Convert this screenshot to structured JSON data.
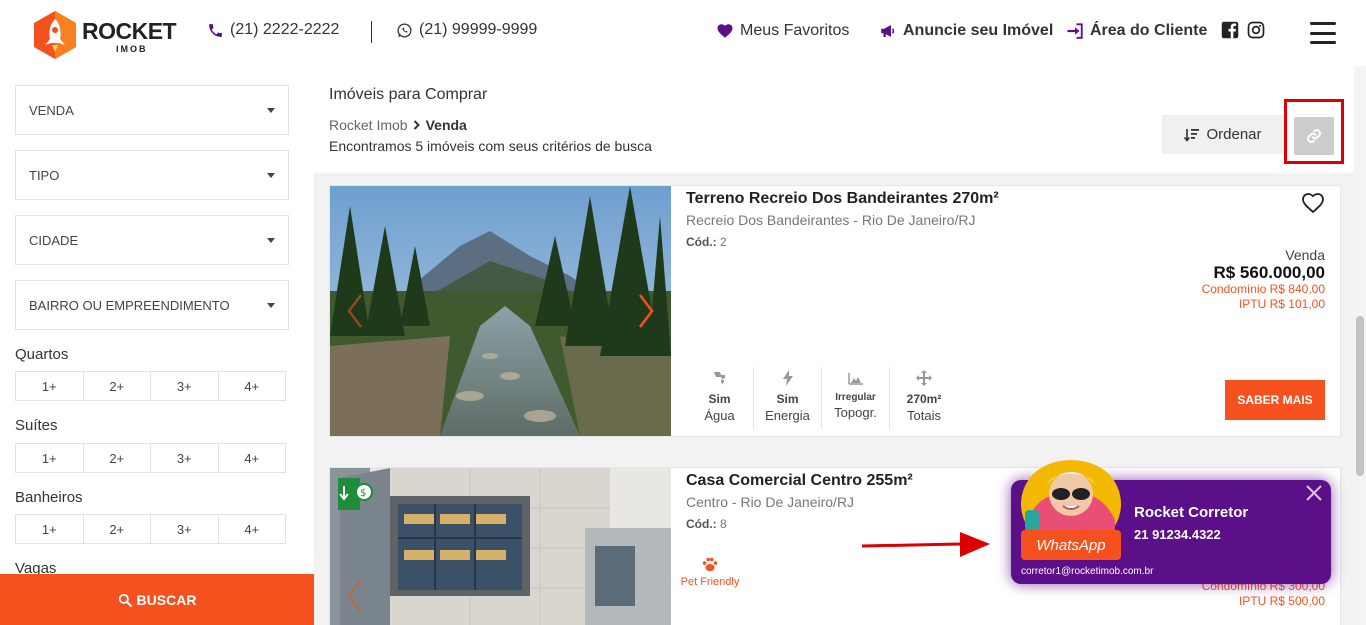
{
  "brand": {
    "name": "ROCKET",
    "sub": "IMOB"
  },
  "header": {
    "phone": "(21) 2222-2222",
    "whatsapp": "(21) 99999-9999",
    "favorites": "Meus Favoritos",
    "advertise": "Anuncie seu Imóvel",
    "client_area": "Área do Cliente",
    "icons": [
      "phone-icon",
      "whatsapp-icon",
      "heart-icon",
      "megaphone-icon",
      "sign-in-icon",
      "facebook-icon",
      "instagram-icon",
      "menu-icon"
    ]
  },
  "filters": {
    "selects": [
      "VENDA",
      "TIPO",
      "CIDADE",
      "BAIRRO OU EMPREENDIMENTO"
    ],
    "groups": [
      {
        "label": "Quartos",
        "options": [
          "1+",
          "2+",
          "3+",
          "4+"
        ]
      },
      {
        "label": "Suítes",
        "options": [
          "1+",
          "2+",
          "3+",
          "4+"
        ]
      },
      {
        "label": "Banheiros",
        "options": [
          "1+",
          "2+",
          "3+",
          "4+"
        ]
      },
      {
        "label": "Vagas"
      }
    ],
    "search_label": "BUSCAR"
  },
  "page": {
    "title": "Imóveis para Comprar",
    "breadcrumb": {
      "root": "Rocket Imob",
      "current": "Venda"
    },
    "result_count": "Encontramos 5 imóveis com seus critérios de busca",
    "order_label": "Ordenar"
  },
  "listings": [
    {
      "title": "Terreno Recreio Dos Bandeirantes 270m²",
      "location": "Recreio Dos Bandeirantes - Rio De Janeiro/RJ",
      "code_label": "Cód.:",
      "code": "2",
      "price_kind": "Venda",
      "price": "R$ 560.000,00",
      "condo": "Condomínio R$ 840,00",
      "iptu": "IPTU R$ 101,00",
      "features": [
        {
          "icon": "water-icon",
          "value": "Sim",
          "label": "Água"
        },
        {
          "icon": "lightning-icon",
          "value": "Sim",
          "label": "Energia"
        },
        {
          "icon": "terrain-icon",
          "value": "Irregular",
          "label": "Topogr."
        },
        {
          "icon": "arrows-icon",
          "value": "270m²",
          "label": "Totais"
        }
      ],
      "cta": "SABER MAIS"
    },
    {
      "title": "Casa Comercial Centro 255m²",
      "location": "Centro - Rio De Janeiro/RJ",
      "code_label": "Cód.:",
      "code": "8",
      "pet_label": "Pet Friendly",
      "condo": "Condomínio R$ 300,00",
      "iptu": "IPTU R$ 500,00"
    }
  ],
  "chat": {
    "name": "Rocket Corretor",
    "phone": "21 91234.4322",
    "whatsapp_label": "WhatsApp",
    "email": "corretor1@rocketimob.com.br"
  },
  "colors": {
    "accent": "#f4511e",
    "brand_purple": "#5b0f88",
    "highlight_red": "#dd0000"
  }
}
